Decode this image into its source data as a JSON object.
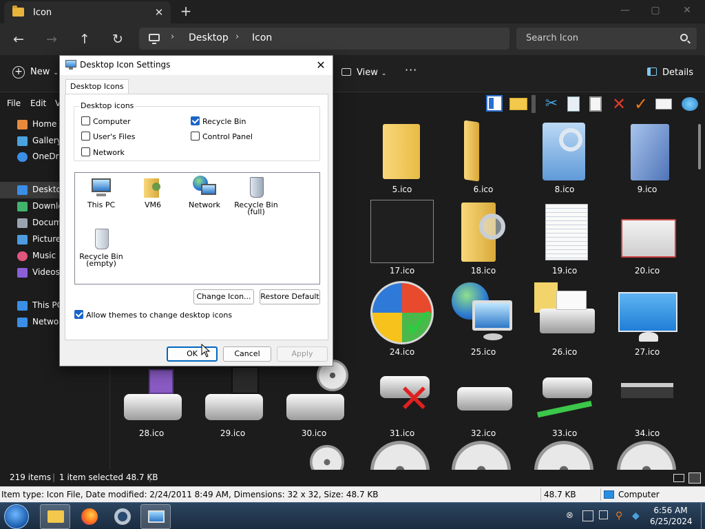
{
  "explorer": {
    "tab_title": "Icon",
    "tab_close": "✕",
    "tab_new": "+",
    "window_controls": [
      "—",
      "▢",
      "✕"
    ],
    "nav": {
      "back": "←",
      "forward": "→",
      "up": "↑",
      "refresh": "↻"
    },
    "breadcrumb": [
      "Desktop",
      "Icon"
    ],
    "breadcrumb_sep": "›",
    "search_placeholder": "Search Icon",
    "commands": {
      "new": "New",
      "view": "View",
      "more": "···",
      "details": "Details"
    },
    "menu": [
      "File",
      "Edit",
      "V"
    ],
    "nav_items": [
      {
        "label": "Home",
        "color": "#e88a3c"
      },
      {
        "label": "Gallery",
        "color": "#4aa3df"
      },
      {
        "label": "OneDriv",
        "color": "#3a8ee6"
      },
      {
        "label": "Desktop",
        "color": "#3a8ee6"
      },
      {
        "label": "Downlo",
        "color": "#41b36b"
      },
      {
        "label": "Docum",
        "color": "#9aa4b0"
      },
      {
        "label": "Picture",
        "color": "#4f9be0"
      },
      {
        "label": "Music",
        "color": "#e0567c"
      },
      {
        "label": "Videos",
        "color": "#8c5fd6"
      },
      {
        "label": "This PC",
        "color": "#3a8ee6"
      },
      {
        "label": "Networ",
        "color": "#3a8ee6"
      }
    ],
    "files": [
      "5.ico",
      "6.ico",
      "8.ico",
      "9.ico",
      "17.ico",
      "18.ico",
      "19.ico",
      "20.ico",
      "24.ico",
      "25.ico",
      "26.ico",
      "27.ico",
      "28.ico",
      "29.ico",
      "30.ico",
      "31.ico",
      "32.ico",
      "33.ico",
      "34.ico"
    ],
    "status": {
      "count": "219 items",
      "selected": "1 item selected  48.7 KB"
    },
    "status_bar": {
      "info": "Item type: Icon File, Date modified: 2/24/2011 8:49 AM, Dimensions: 32 x 32, Size: 48.7 KB",
      "size": "48.7 KB",
      "location": "Computer"
    }
  },
  "dialog": {
    "title": "Desktop Icon Settings",
    "close": "✕",
    "tab": "Desktop Icons",
    "group_label": "Desktop icons",
    "checkboxes": [
      {
        "label": "Computer",
        "checked": false
      },
      {
        "label": "Recycle Bin",
        "checked": true
      },
      {
        "label": "User's Files",
        "checked": false
      },
      {
        "label": "Control Panel",
        "checked": false
      },
      {
        "label": "Network",
        "checked": false
      }
    ],
    "icons": [
      {
        "line1": "This PC",
        "line2": ""
      },
      {
        "line1": "VM6",
        "line2": ""
      },
      {
        "line1": "Network",
        "line2": ""
      },
      {
        "line1": "Recycle Bin",
        "line2": "(full)"
      },
      {
        "line1": "Recycle Bin",
        "line2": "(empty)"
      }
    ],
    "change_icon": "Change Icon...",
    "restore_default": "Restore Default",
    "allow_themes": "Allow themes to change desktop icons",
    "allow_themes_checked": true,
    "ok": "OK",
    "cancel": "Cancel",
    "apply": "Apply"
  },
  "taskbar": {
    "time": "6:56 AM",
    "date": "6/25/2024"
  }
}
